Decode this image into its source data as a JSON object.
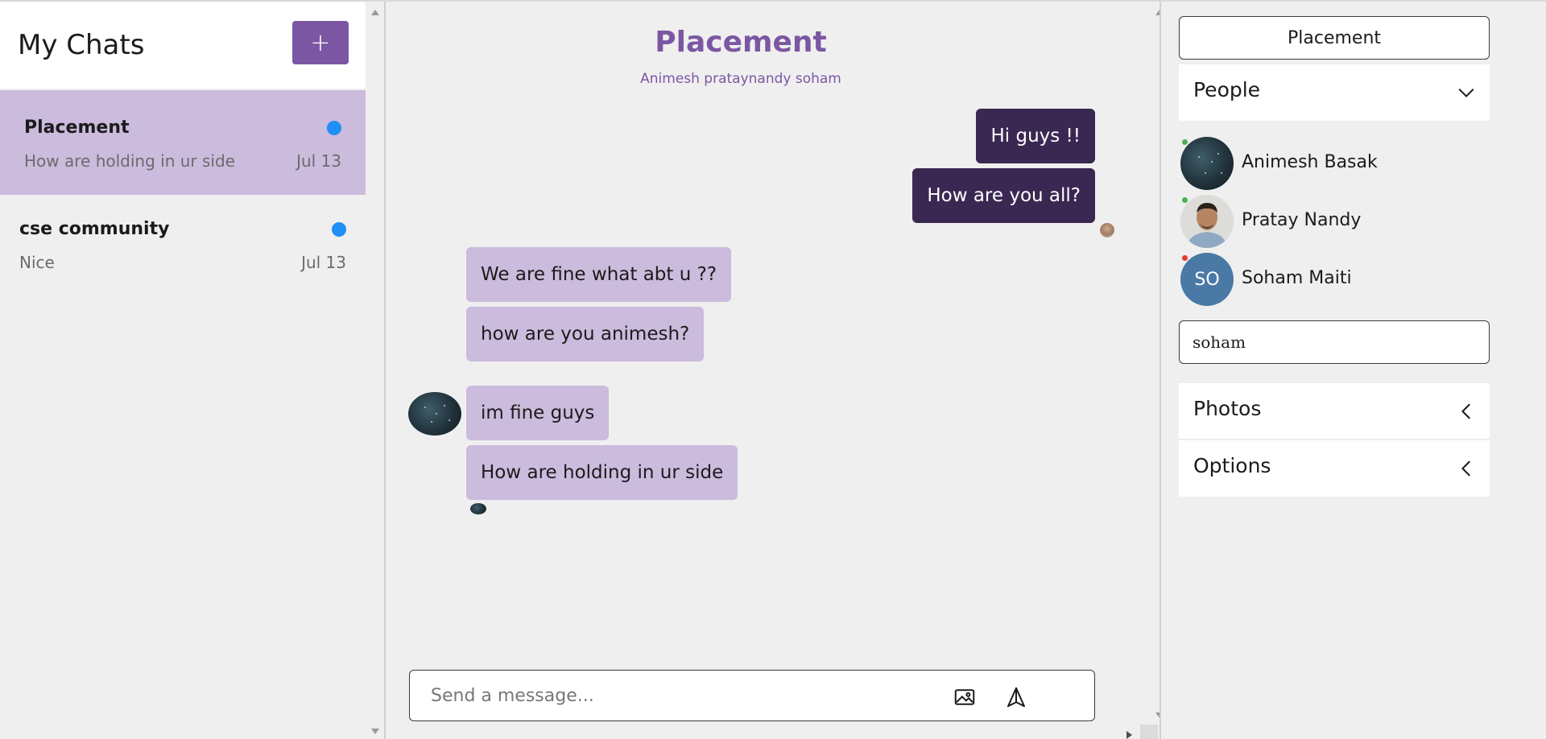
{
  "sidebar": {
    "title": "My Chats",
    "new_button_label": "+",
    "chats": [
      {
        "name": "Placement",
        "preview": "How are holding in ur side",
        "date": "Jul 13",
        "unread": true,
        "active": true
      },
      {
        "name": "cse community",
        "preview": "Nice",
        "date": "Jul 13",
        "unread": true,
        "active": false
      }
    ]
  },
  "chat": {
    "title": "Placement",
    "members": "Animesh prataynandy soham",
    "messages": [
      {
        "text": "Hi guys !!",
        "direction": "out"
      },
      {
        "text": "How are you all?",
        "direction": "out"
      },
      {
        "text": "We are fine what abt u ??",
        "direction": "in"
      },
      {
        "text": "how are you animesh?",
        "direction": "in"
      },
      {
        "text": "im fine guys",
        "direction": "in"
      },
      {
        "text": "How are holding in ur side",
        "direction": "in"
      }
    ],
    "composer": {
      "placeholder": "Send a message..."
    }
  },
  "right_panel": {
    "group_name": "Placement",
    "people_label": "People",
    "people": [
      {
        "name": "Animesh Basak",
        "status": "online",
        "avatar": "photo"
      },
      {
        "name": "Pratay Nandy",
        "status": "online",
        "avatar": "photo"
      },
      {
        "name": "Soham Maiti",
        "status": "offline",
        "avatar": "initials",
        "initials": "SO"
      }
    ],
    "search_value": "soham",
    "photos_label": "Photos",
    "options_label": "Options"
  },
  "colors": {
    "accent": "#7b57a3",
    "outgoing_bubble": "#3b2852",
    "incoming_bubble": "#cbbbdd",
    "unread_dot": "#2090f5",
    "online": "#4caf50",
    "offline": "#e53935",
    "initials_avatar": "#4a79a5"
  },
  "icons": {
    "send": "send-icon",
    "image": "image-icon",
    "add": "plus-icon",
    "expand": "chevron-down-icon",
    "collapse": "chevron-left-icon"
  }
}
